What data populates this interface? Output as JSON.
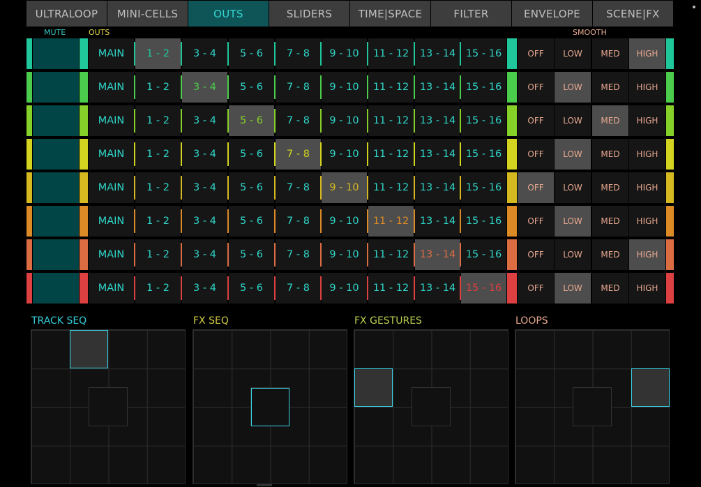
{
  "tabs": [
    "ULTRALOOP",
    "MINI-CELLS",
    "OUTS",
    "SLIDERS",
    "TIME|SPACE",
    "FILTER",
    "ENVELOPE",
    "SCENE|FX"
  ],
  "active_tab": 2,
  "labels": {
    "mute": "MUTE",
    "outs": "OUTS",
    "smooth": "SMOOTH"
  },
  "outs": [
    "MAIN",
    "1 - 2",
    "3 - 4",
    "5 - 6",
    "7 - 8",
    "9 - 10",
    "11 - 12",
    "13 - 14",
    "15 - 16"
  ],
  "smooth_options": [
    "OFF",
    "LOW",
    "MED",
    "HIGH"
  ],
  "tracks": [
    {
      "color": "#1fc79b",
      "selected_out": 1,
      "selected_smooth": 3
    },
    {
      "color": "#4ccc4c",
      "selected_out": 2,
      "selected_smooth": 1
    },
    {
      "color": "#86d02a",
      "selected_out": 3,
      "selected_smooth": 2
    },
    {
      "color": "#d2d420",
      "selected_out": 4,
      "selected_smooth": 1
    },
    {
      "color": "#d6b820",
      "selected_out": 5,
      "selected_smooth": 0
    },
    {
      "color": "#dc8a26",
      "selected_out": 6,
      "selected_smooth": 1
    },
    {
      "color": "#dc6c42",
      "selected_out": 7,
      "selected_smooth": 3
    },
    {
      "color": "#dc4040",
      "selected_out": 8,
      "selected_smooth": 1
    }
  ],
  "pads": [
    {
      "label": "TRACK SEQ",
      "color": "#35cdd8",
      "cursor": {
        "col": 1,
        "row": 0
      }
    },
    {
      "label": "FX SEQ",
      "color": "#d2cc46",
      "cursor": {
        "col": 1.5,
        "row": 1.5
      }
    },
    {
      "label": "FX GESTURES",
      "color": "#bcd050",
      "cursor": {
        "col": 0,
        "row": 1
      }
    },
    {
      "label": "LOOPS",
      "color": "#e8a890",
      "cursor": {
        "col": 3,
        "row": 1
      }
    }
  ],
  "colors": {
    "active_tab_bg": "#0f5457",
    "active_tab_text": "#33d6cf",
    "mute_bg": "#024547",
    "selected_bg": "#4d4d4d"
  }
}
